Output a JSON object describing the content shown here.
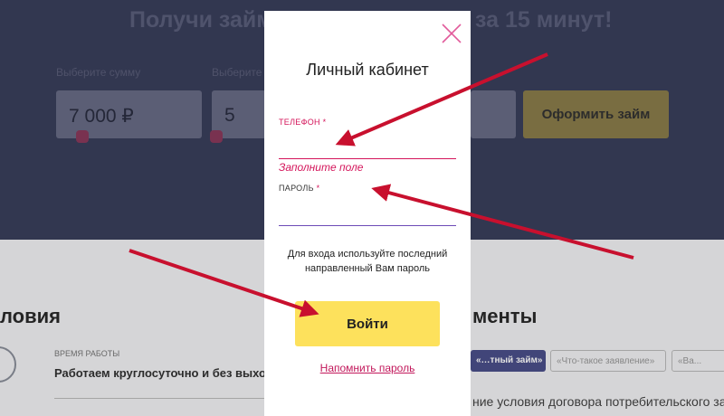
{
  "background": {
    "hero_title_left": "Получи займ",
    "hero_title_right": "за 15 минут!",
    "amount_caption": "Выберите сумму",
    "term_caption": "Выберите",
    "amount_value": "7 000 ₽",
    "term_value": "5",
    "apply_button": "Оформить займ",
    "conditions_title": "ловия",
    "documents_title": "менты",
    "work_hours_caption": "ВРЕМЯ РАБОТЫ",
    "work_hours_text": "Работаем круглосуточно и без выход",
    "doc_tags": [
      "«…тный займ»",
      "«Что-такое заявление»",
      "«Ва..."
    ],
    "docs_text": "ние условия договора потребительского займ"
  },
  "modal": {
    "title": "Личный кабинет",
    "phone_label": "ТЕЛЕФОН",
    "phone_value": "",
    "phone_error": "Заполните поле",
    "password_label": "ПАРОЛЬ",
    "password_value": "",
    "required_mark": "*",
    "hint_line1": "Для входа используйте последний",
    "hint_line2": "направленный Вам пароль",
    "login_button": "Войти",
    "remind_link": "Напомнить пароль"
  },
  "colors": {
    "accent": "#d4145a",
    "button_yellow": "#fde15c",
    "arrow_red": "#c8102e",
    "hero_bg": "#3a3f5c"
  }
}
